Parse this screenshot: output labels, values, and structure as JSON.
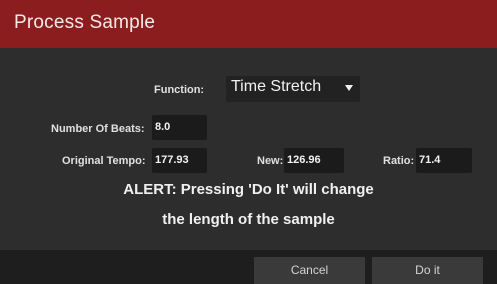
{
  "dialog": {
    "title": "Process Sample"
  },
  "function": {
    "label": "Function:",
    "value": "Time Stretch"
  },
  "beats": {
    "label": "Number Of Beats:",
    "value": "8.0"
  },
  "tempo": {
    "original_label": "Original Tempo:",
    "original_value": "177.93",
    "new_label": "New:",
    "new_value": "126.96",
    "ratio_label": "Ratio:",
    "ratio_value": "71.4"
  },
  "alert": {
    "line1": "ALERT: Pressing 'Do It' will change",
    "line2": "the length of the sample"
  },
  "buttons": {
    "cancel": "Cancel",
    "do_it": "Do it"
  },
  "colors": {
    "title_bar": "#8c1d1f",
    "dialog_bg": "#2d2d2d",
    "field_bg": "#1b1b1b",
    "button_bg": "#3a3a3a"
  },
  "icons": {
    "function_dropdown": "caret-down-icon"
  }
}
